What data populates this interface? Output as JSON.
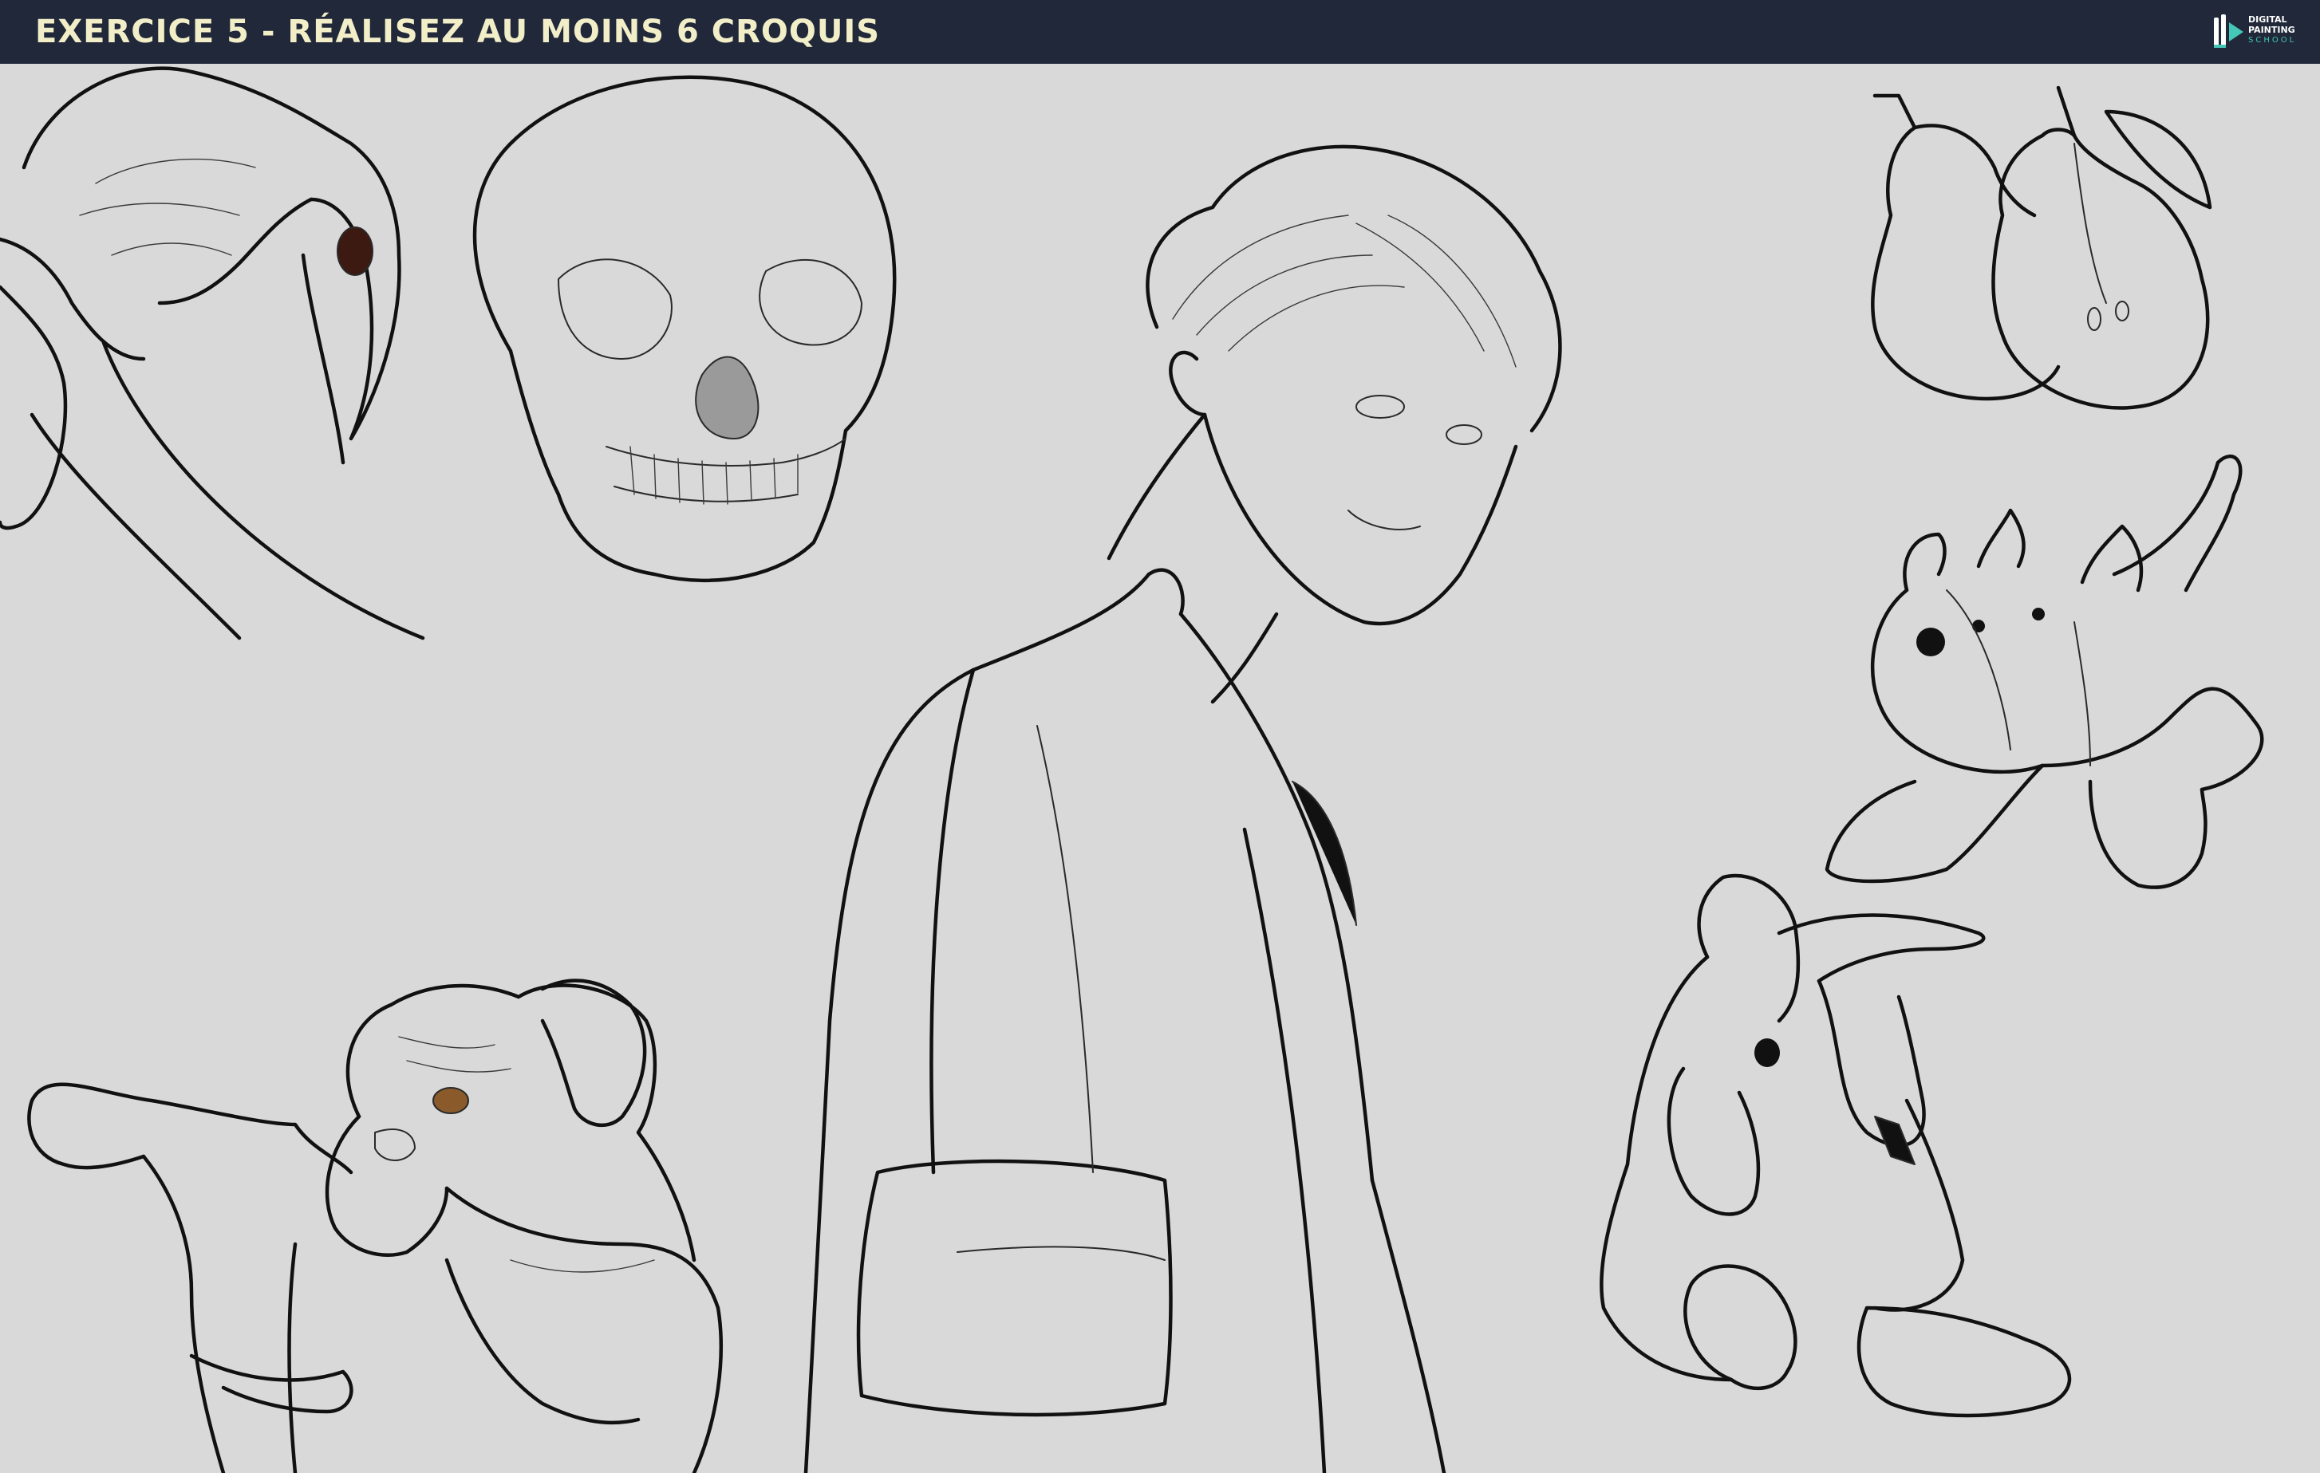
{
  "header": {
    "title": "EXERCICE 5 - RÉALISEZ AU MOINS 6 CROQUIS",
    "background_color": "#20283a",
    "title_color": "#f2eec8"
  },
  "logo": {
    "line1": "DIGITAL",
    "line2": "PAINTING",
    "line3": "SCHOOL",
    "accent_color": "#45c6b6"
  },
  "canvas": {
    "background_color": "#d9d9d9",
    "line_color": "#111111"
  }
}
